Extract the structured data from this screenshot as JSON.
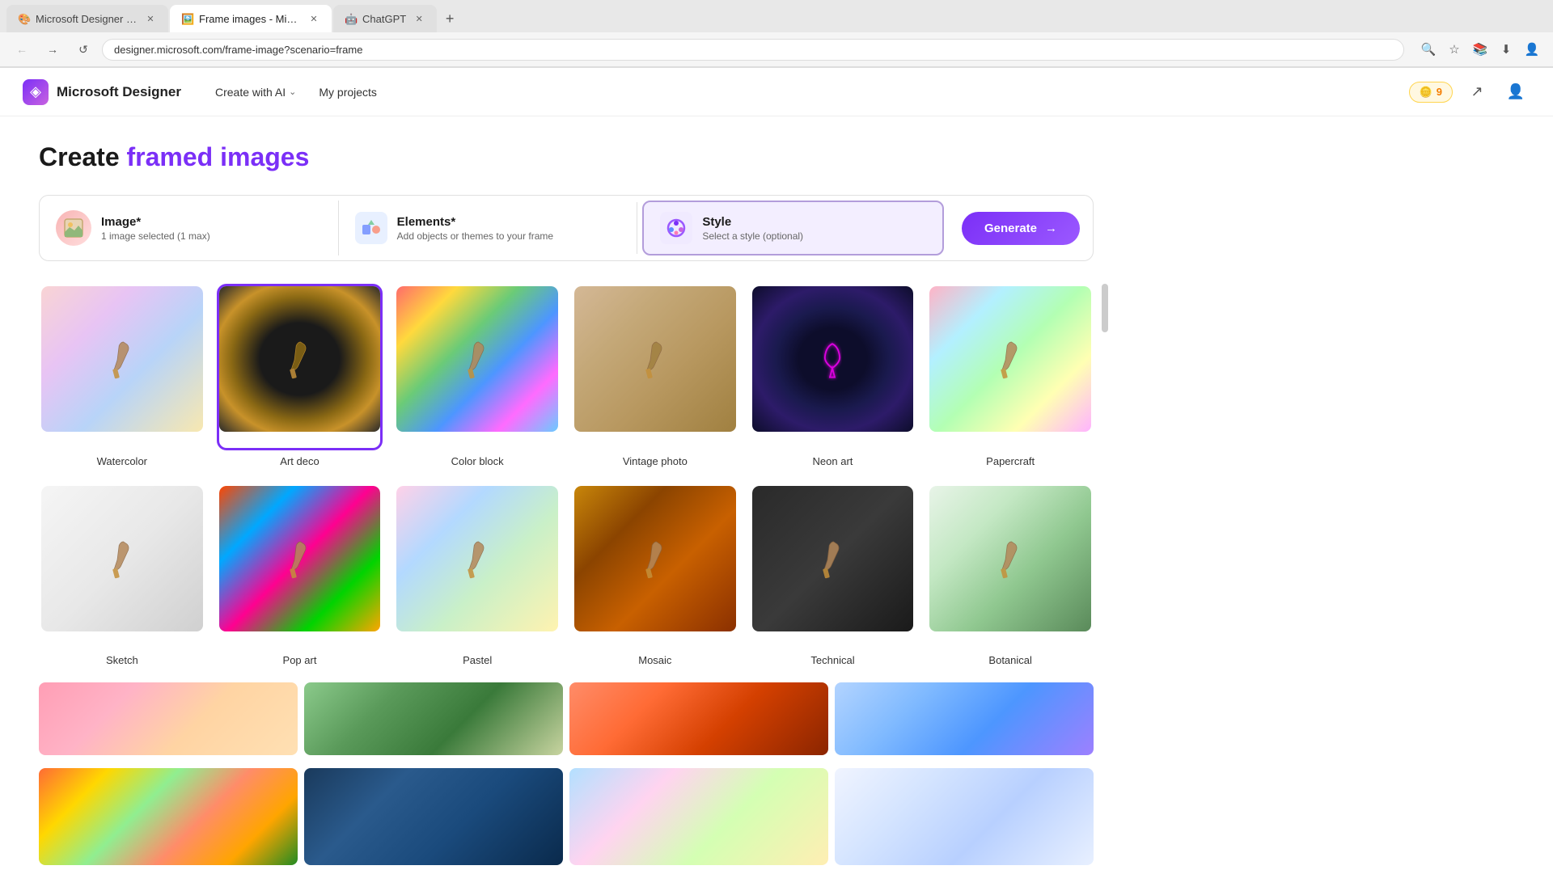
{
  "browser": {
    "tabs": [
      {
        "label": "Microsoft Designer - Stunning...",
        "active": false,
        "favicon": "🎨"
      },
      {
        "label": "Frame images - Microsoft Des...",
        "active": true,
        "favicon": "🖼️"
      },
      {
        "label": "ChatGPT",
        "active": false,
        "favicon": "🤖"
      }
    ],
    "url": "designer.microsoft.com/frame-image?scenario=frame"
  },
  "header": {
    "logo_text": "Microsoft Designer",
    "nav": [
      {
        "label": "Create with AI",
        "has_dropdown": true
      },
      {
        "label": "My projects",
        "has_dropdown": false
      }
    ],
    "coins": "9",
    "coin_label": "9"
  },
  "page": {
    "title_plain": "Create ",
    "title_highlight": "framed images"
  },
  "toolbar": {
    "image_label": "Image*",
    "image_sub": "1 image selected (1 max)",
    "elements_label": "Elements*",
    "elements_sub": "Add objects or themes to your frame",
    "style_label": "Style",
    "style_sub": "Select a style (optional)",
    "generate_label": "Generate"
  },
  "styles": [
    {
      "name": "Watercolor",
      "img_class": "img-watercolor",
      "selected": false
    },
    {
      "name": "Art deco",
      "img_class": "img-artdeco",
      "selected": true
    },
    {
      "name": "Color block",
      "img_class": "img-colorblock",
      "selected": false
    },
    {
      "name": "Vintage photo",
      "img_class": "img-vintage",
      "selected": false
    },
    {
      "name": "Neon art",
      "img_class": "img-neon",
      "selected": false
    },
    {
      "name": "Papercraft",
      "img_class": "img-papercraft",
      "selected": false
    },
    {
      "name": "Sketch",
      "img_class": "img-sketch",
      "selected": false
    },
    {
      "name": "Pop art",
      "img_class": "img-popArt",
      "selected": false
    },
    {
      "name": "Pastel",
      "img_class": "img-pastel",
      "selected": false
    },
    {
      "name": "Mosaic",
      "img_class": "img-mosaic",
      "selected": false
    },
    {
      "name": "Technical",
      "img_class": "img-technical",
      "selected": false
    },
    {
      "name": "Botanical",
      "img_class": "img-botanical",
      "selected": false
    }
  ],
  "bottom_strips": {
    "row1": [
      {
        "img_class": "img-strip1"
      },
      {
        "img_class": "img-strip2"
      },
      {
        "img_class": "img-strip3"
      },
      {
        "img_class": "img-strip4"
      }
    ],
    "row2": [
      {
        "img_class": "img-food"
      },
      {
        "img_class": "img-tools"
      },
      {
        "img_class": "img-sticker"
      },
      {
        "img_class": "img-cats"
      }
    ]
  },
  "icons": {
    "designer_logo": "◈",
    "coin": "🪙",
    "share": "↗",
    "account": "👤",
    "back": "←",
    "forward": "→",
    "refresh": "↺",
    "star": "☆",
    "download": "⬇",
    "chevron_down": "⌄",
    "arrow_right": "→"
  }
}
